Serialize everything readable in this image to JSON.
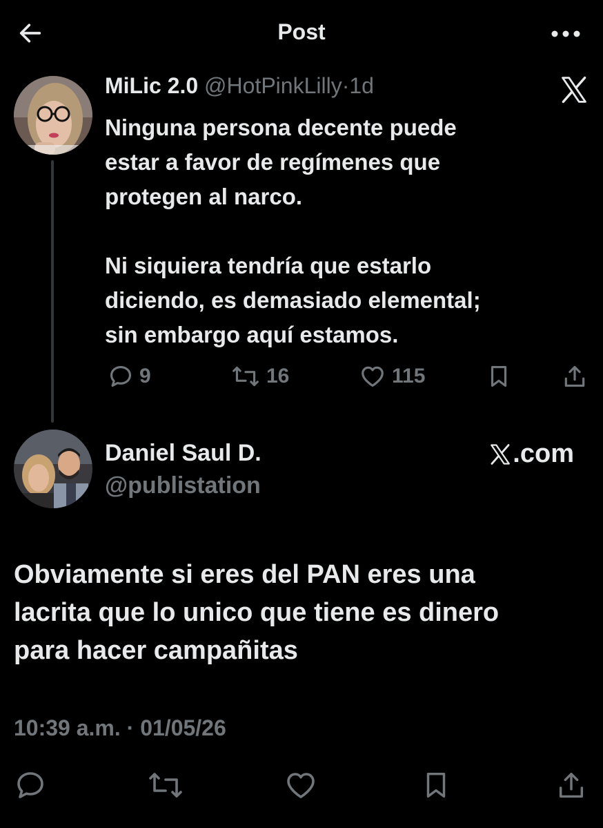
{
  "header": {
    "title": "Post",
    "back_icon": "arrow-left-icon",
    "more_icon": "more-horizontal-icon"
  },
  "quoted_post": {
    "display_name": "MiLic 2.0",
    "handle": "@HotPinkLilly",
    "separator": "·",
    "time": "1d",
    "text": "Ninguna persona decente puede\nestar a favor de regímenes que\nprotegen al narco.\n\nNi siquiera tendría que estarlo\ndiciendo, es demasiado elemental;\nsin embargo aquí estamos.",
    "replies": "9",
    "reposts": "16",
    "likes": "115"
  },
  "main_post": {
    "display_name": "Daniel Saul D.",
    "handle": "@publistation",
    "source_label": ".com",
    "text": "Obviamente si eres del PAN eres una\nlacrita que lo unico que tiene es dinero\npara hacer campañitas",
    "time": "10:39 a.m.",
    "separator": "·",
    "date": "01/05/26"
  },
  "colors": {
    "background": "#000000",
    "text": "#e7e9ea",
    "muted": "#71767b"
  }
}
